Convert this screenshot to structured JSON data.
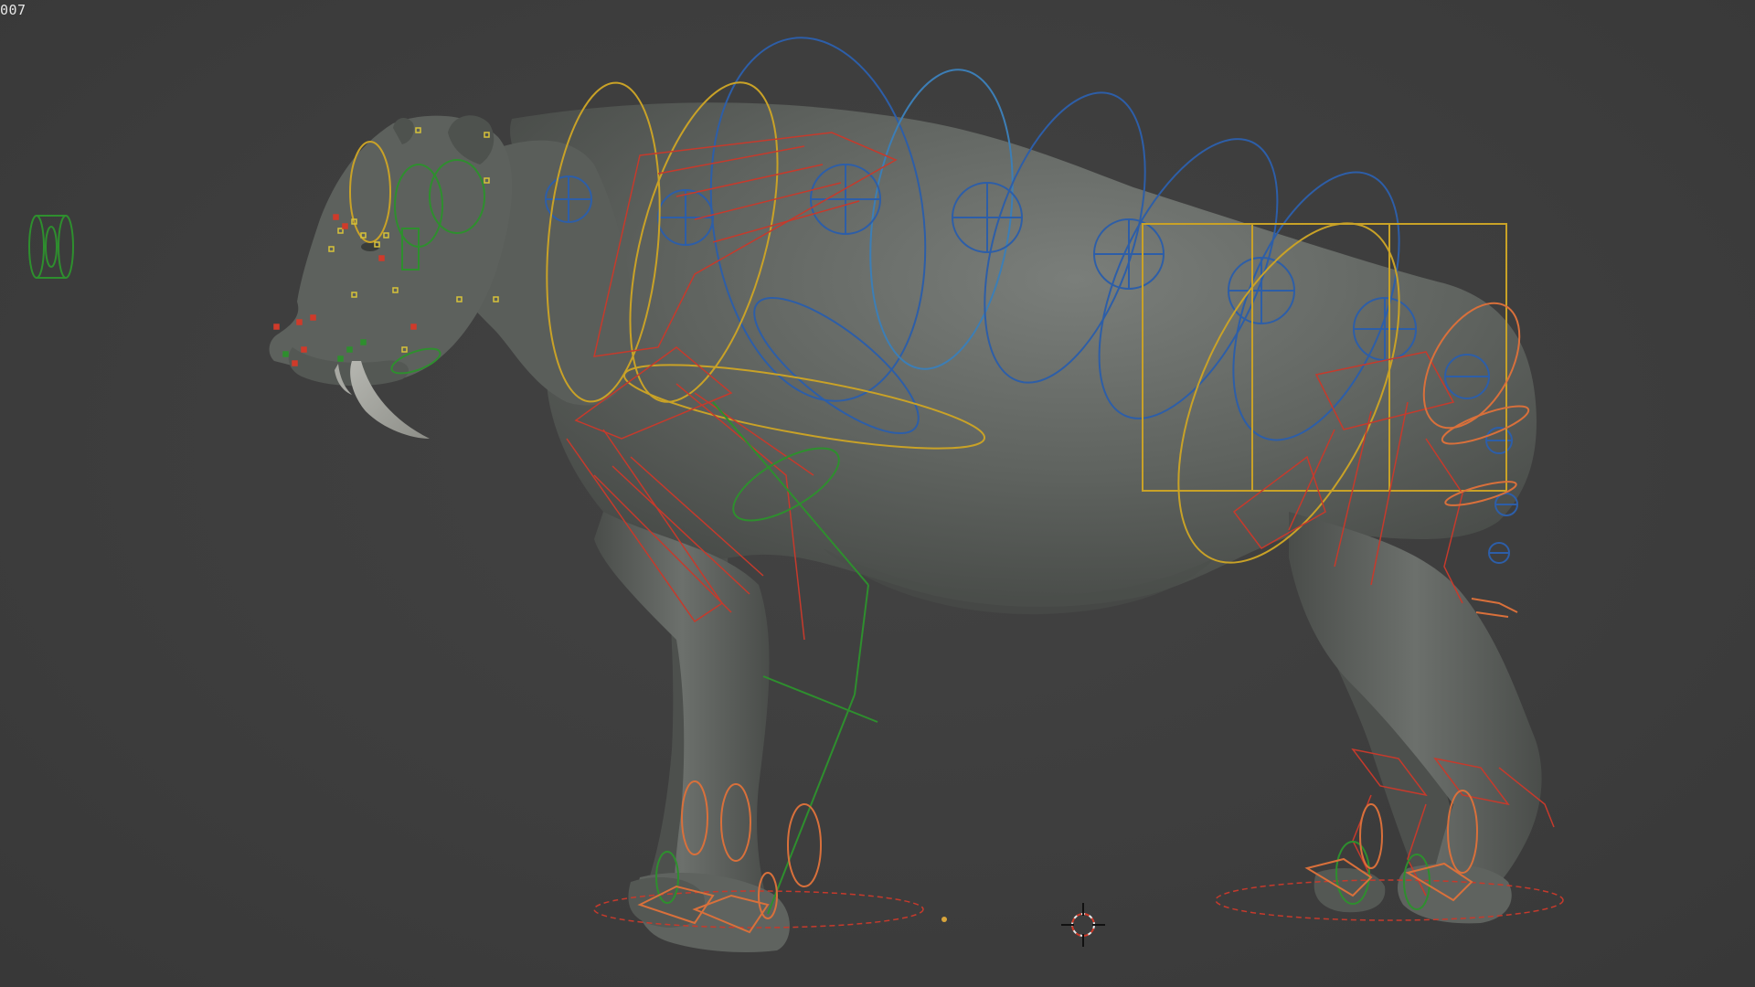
{
  "viewport": {
    "frame_label": "007",
    "background_color": "#3d3d3d"
  },
  "subject": {
    "body_color": "#5f635f",
    "shadow_color": "#3f423f",
    "highlight_color": "#747874"
  },
  "rig": {
    "colors": {
      "spine_controls": "#2d5ea8",
      "spine_controls_light": "#3c7eb6",
      "cog_controls": "#c9a227",
      "fk_arm_controls": "#c63a2c",
      "ik_controls": "#2e8f2e",
      "foot_controls": "#d9703b",
      "face_markers_yellow": "#d7c23a",
      "face_markers_red": "#d03a2a"
    },
    "icons": {
      "camera_target": "crosshair-icon",
      "world_pivot": "dot-icon",
      "side_control": "cylinder-control-icon"
    }
  }
}
